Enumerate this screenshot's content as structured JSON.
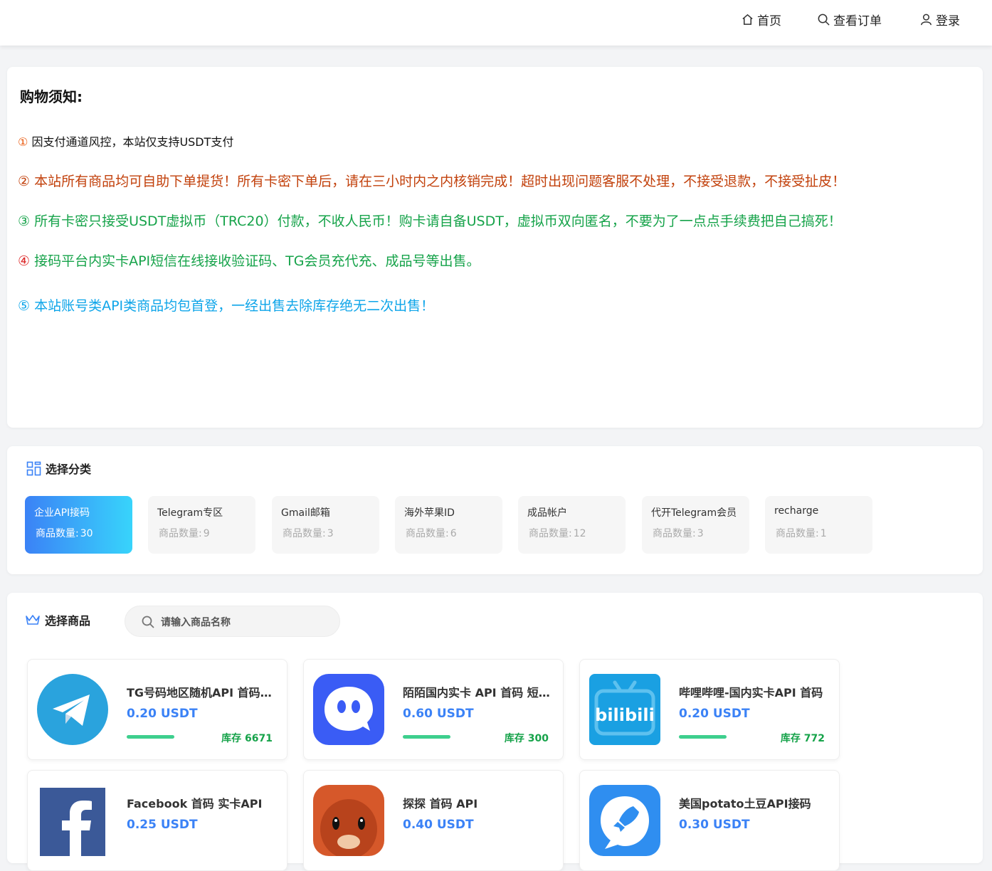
{
  "nav": {
    "home": "首页",
    "orders": "查看订单",
    "login": "登录"
  },
  "notice": {
    "title": "购物须知:",
    "items": [
      {
        "marker": "①",
        "text": "因支付通道风控，本站仅支持USDT支付",
        "color": "#111111",
        "marker_color": "#ea580c"
      },
      {
        "marker": "②",
        "text": "本站所有商品均可自助下单提货！所有卡密下单后，请在三小时内之内核销完成！超时出现问题客服不处理，不接受退款，不接受扯皮！",
        "color": "#c2410c",
        "marker_color": "#c2410c"
      },
      {
        "marker": "③",
        "text": "所有卡密只接受USDT虚拟币（TRC20）付款，不收人民币！购卡请自备USDT，虚拟币双向匿名，不要为了一点点手续费把自己搞死！",
        "color": "#16a34a",
        "marker_color": "#16a34a"
      },
      {
        "marker": "④",
        "text": "接码平台内实卡API短信在线接收验证码、TG会员充代充、成品号等出售。",
        "color": "#16a34a",
        "marker_color": "#dc2626"
      },
      {
        "marker": "⑤",
        "text": "本站账号类API类商品均包首登，一经出售去除库存绝无二次出售！",
        "color": "#0ea5e9",
        "marker_color": "#0ea5e9"
      }
    ]
  },
  "categories": {
    "title": "选择分类",
    "count_label": "商品数量:",
    "items": [
      {
        "name": "企业API接码",
        "count": "30",
        "active": true
      },
      {
        "name": "Telegram专区",
        "count": "9",
        "active": false
      },
      {
        "name": "Gmail邮箱",
        "count": "3",
        "active": false
      },
      {
        "name": "海外苹果ID",
        "count": "6",
        "active": false
      },
      {
        "name": "成品帐户",
        "count": "12",
        "active": false
      },
      {
        "name": "代开Telegram会员",
        "count": "3",
        "active": false
      },
      {
        "name": "recharge",
        "count": "1",
        "active": false
      }
    ]
  },
  "products": {
    "title": "选择商品",
    "search_placeholder": "请输入商品名称",
    "stock_label": "库存",
    "items": [
      {
        "name": "TG号码地区随机API 首码实卡",
        "price": "0.20 USDT",
        "stock": "6671",
        "icon": "telegram-icon"
      },
      {
        "name": "陌陌国内实卡 API 首码 短信接码",
        "price": "0.60 USDT",
        "stock": "300",
        "icon": "momo-icon"
      },
      {
        "name": "哔哩哔哩-国内实卡API 首码",
        "price": "0.20 USDT",
        "stock": "772",
        "icon": "bilibili-icon"
      },
      {
        "name": "Facebook 首码 实卡API",
        "price": "0.25 USDT",
        "stock": "",
        "icon": "facebook-icon"
      },
      {
        "name": "探探 首码 API",
        "price": "0.40 USDT",
        "stock": "",
        "icon": "tantan-icon"
      },
      {
        "name": "美国potato土豆API接码",
        "price": "0.30 USDT",
        "stock": "",
        "icon": "potato-icon"
      }
    ]
  },
  "colors": {
    "accent": "#3b82f6",
    "stock_green": "#16a34a"
  }
}
